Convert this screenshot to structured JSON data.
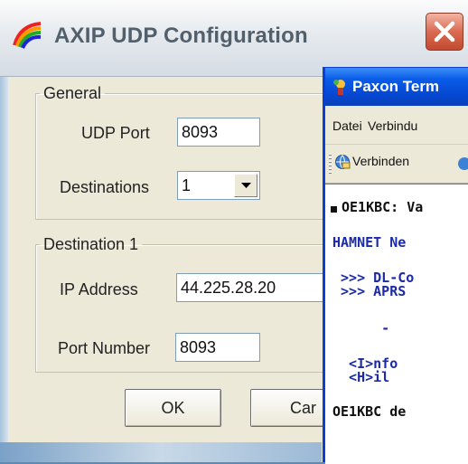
{
  "axip_dialog": {
    "title": "AXIP UDP Configuration",
    "general_group": {
      "legend": "General",
      "udp_port_label": "UDP Port",
      "udp_port_value": "8093",
      "destinations_label": "Destinations",
      "destinations_value": "1"
    },
    "destination_group": {
      "legend": "Destination 1",
      "ip_label": "IP Address",
      "ip_value": "44.225.28.20",
      "port_label": "Port Number",
      "port_value": "8093"
    },
    "ok_label": "OK",
    "cancel_label": "Car"
  },
  "paxon_window": {
    "title": "Paxon Term",
    "menu": [
      "Datei",
      "Verbindu"
    ],
    "toolbar_connect": "Verbinden",
    "terminal_lines": [
      "OE1KBC: Va",
      "HAMNET Ne",
      " >>> DL-Co",
      " >>> APRS",
      "      -",
      "  <I>nfo",
      "  <H>il",
      "OE1KBC de"
    ]
  },
  "colors": {
    "dialog_bg": "#ece9d8",
    "xp_blue_title": "#0548d3",
    "close_red": "#d96b52",
    "terminal_blue_text": "#1a2aa8"
  }
}
